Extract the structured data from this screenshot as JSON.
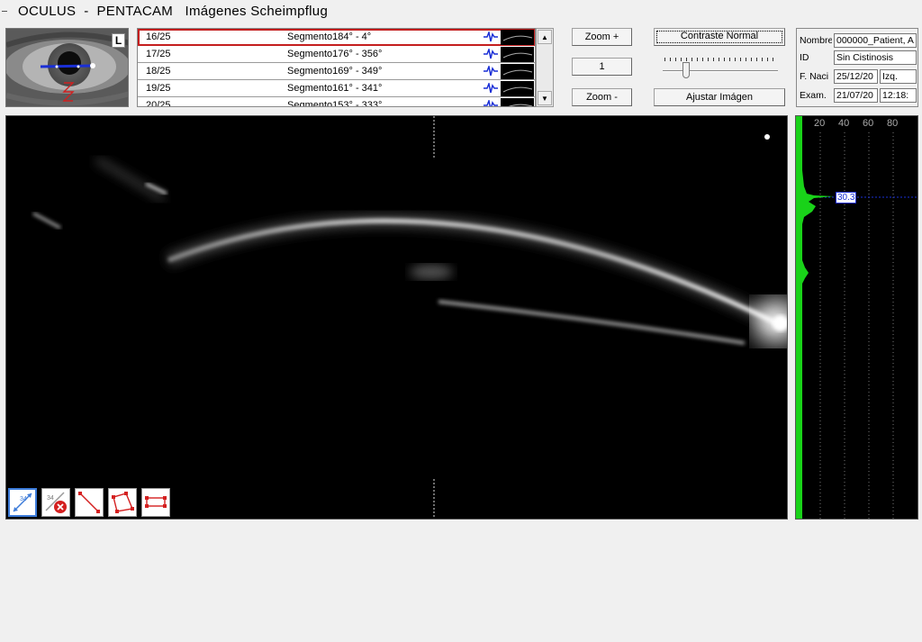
{
  "window": {
    "title": "OCULUS  -  PENTACAM   Imágenes Scheimpflug"
  },
  "eye": {
    "side": "L"
  },
  "segments": {
    "rows": [
      {
        "index": "16/25",
        "name": "Segmento184° - 4°",
        "selected": true
      },
      {
        "index": "17/25",
        "name": "Segmento176° - 356°",
        "selected": false
      },
      {
        "index": "18/25",
        "name": "Segmento169° - 349°",
        "selected": false
      },
      {
        "index": "19/25",
        "name": "Segmento161° - 341°",
        "selected": false
      },
      {
        "index": "20/25",
        "name": "Segmento153° - 333°",
        "selected": false
      }
    ]
  },
  "scrollbar": {
    "up_glyph": "▲",
    "down_glyph": "▼"
  },
  "zoom": {
    "zoom_in_label": "Zoom +",
    "zoom_value": "1",
    "zoom_out_label": "Zoom -"
  },
  "contrast": {
    "normal_label": "Contraste Normal",
    "adjust_label": "Ajustar Imágen",
    "slider_level": 0.18
  },
  "patient": {
    "name_label": "Nombre",
    "name_value": "000000_Patient, A",
    "id_label": "ID",
    "id_value": "Sin Cistinosis",
    "dob_label": "F. Naci",
    "dob_value": "25/12/20",
    "eye_value": "Izq.",
    "exam_label": "Exam.",
    "exam_date": "21/07/20",
    "exam_time": "12:18:"
  },
  "histogram": {
    "ticks": [
      "20",
      "40",
      "60",
      "80"
    ],
    "value_label": "30.3",
    "color": "#19d219"
  },
  "colors": {
    "selection": "#c41e1e",
    "accent": "#3c7bd9",
    "wave": "#1a2fd6"
  },
  "tools": [
    {
      "name": "measure-distance-icon",
      "active": true
    },
    {
      "name": "delete-measure-icon",
      "active": false
    },
    {
      "name": "line-tool-icon",
      "active": false
    },
    {
      "name": "polygon-tool-icon",
      "active": false
    },
    {
      "name": "rectangle-tool-icon",
      "active": false
    }
  ]
}
